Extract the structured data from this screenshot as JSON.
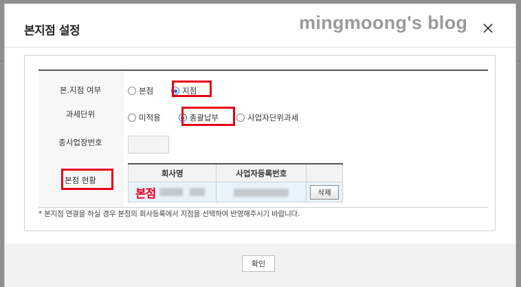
{
  "dialog": {
    "title": "본지점 설정",
    "watermark": "mingmoong's blog"
  },
  "rows": {
    "branch_type": {
      "label": "본.지점 여부",
      "options": [
        "본점",
        "지점"
      ],
      "selected": "지점"
    },
    "tax_unit": {
      "label": "과세단위",
      "options": [
        "미적용",
        "총괄납부",
        "사업자단위과세"
      ],
      "selected": "총괄납부"
    },
    "sub_business_no": {
      "label": "종사업장번호",
      "value": ""
    },
    "hq_status": {
      "label": "본점 현황",
      "columns": [
        "회사명",
        "사업자등록번호",
        ""
      ],
      "row": {
        "company_annotation": "본점",
        "delete_label": "삭제"
      }
    }
  },
  "notice": "* 본지점 연결을 하실 경우 본점의 회사등록에서 지점을 선택하여 반영해주시기 바랍니다.",
  "footer": {
    "ok_label": "확인"
  },
  "colors": {
    "highlight": "#e60012",
    "radio_checked": "#1f6fd6",
    "selected_row": "#e8f3fb"
  }
}
